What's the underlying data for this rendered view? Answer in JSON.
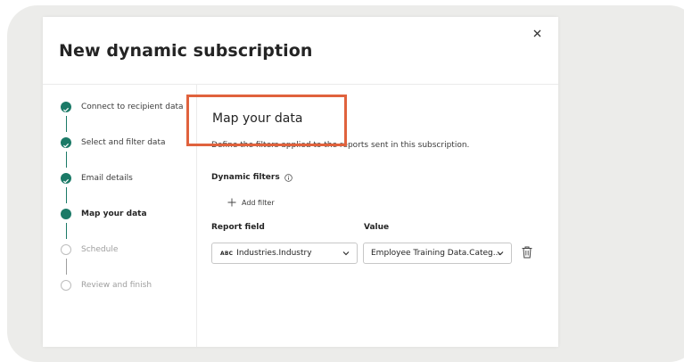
{
  "dialog": {
    "title": "New dynamic subscription"
  },
  "steps": [
    {
      "label": "Connect to recipient data",
      "state": "done"
    },
    {
      "label": "Select and filter data",
      "state": "done"
    },
    {
      "label": "Email details",
      "state": "done"
    },
    {
      "label": "Map your data",
      "state": "current"
    },
    {
      "label": "Schedule",
      "state": "pending"
    },
    {
      "label": "Review and finish",
      "state": "pending"
    }
  ],
  "main": {
    "section_title": "Map your data",
    "section_description": "Define the filters applied to the reports sent in this subscription.",
    "dynamic_filters_label": "Dynamic filters",
    "add_filter_label": "Add filter",
    "report_field_label": "Report field",
    "value_label": "Value",
    "report_field_type_badge": "ABC",
    "report_field_value": "Industries.Industry",
    "value_value": "Employee Training Data.Categ..."
  },
  "colors": {
    "accent": "#1b7a67",
    "highlight_border": "#e0623d",
    "pending": "#bdbdbd"
  },
  "icons": {
    "close": "close-icon",
    "info": "info-icon",
    "add": "plus-icon",
    "chevron": "chevron-down-icon",
    "delete": "trash-icon"
  }
}
